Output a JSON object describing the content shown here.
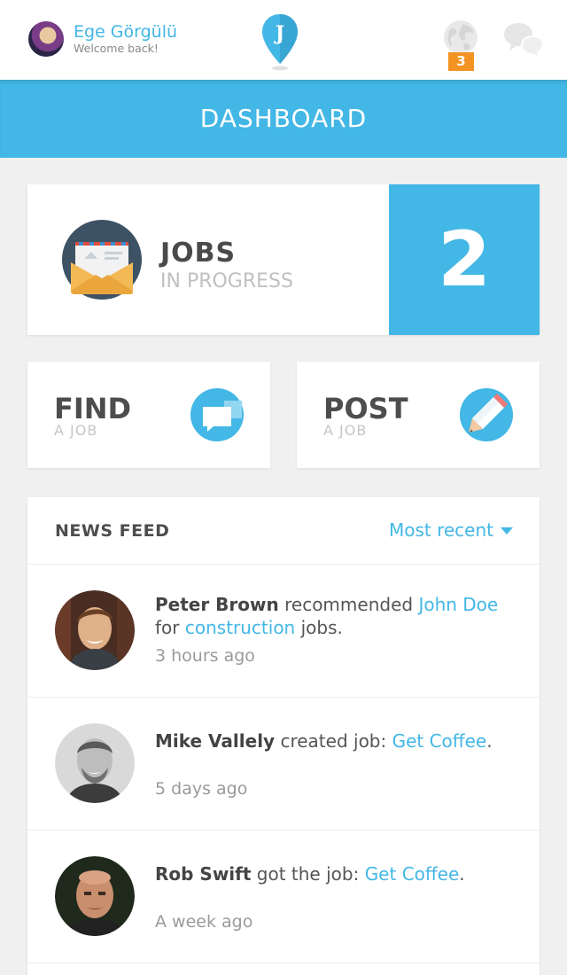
{
  "user": {
    "name": "Ege Görgülü",
    "subtitle": "Welcome back!"
  },
  "logo": {
    "letter": "J"
  },
  "notifications": {
    "count": "3"
  },
  "header": {
    "title": "DASHBOARD"
  },
  "jobs": {
    "title": "JOBS",
    "subtitle": "IN PROGRESS",
    "count": "2"
  },
  "find": {
    "title": "FIND",
    "subtitle": "A JOB"
  },
  "post": {
    "title": "POST",
    "subtitle": "A JOB"
  },
  "feed": {
    "title": "NEWS FEED",
    "sort_label": "Most recent",
    "items": [
      {
        "actor": "Peter Brown",
        "verb": " recommended ",
        "target": "John Doe",
        "mid": " for ",
        "target2": "construction",
        "tail": " jobs.",
        "time": "3 hours ago"
      },
      {
        "actor": "Mike Vallely",
        "verb": " created job: ",
        "target": "Get Coffee",
        "tail": ".",
        "time": "5 days ago"
      },
      {
        "actor": "Rob Swift",
        "verb": " got the job: ",
        "target": "Get Coffee",
        "tail": ".",
        "time": "A week ago"
      }
    ]
  },
  "colors": {
    "accent": "#43b7e5",
    "badge": "#f29322"
  },
  "icons": {
    "globe": "globe-icon",
    "chat": "chat-bubbles-icon",
    "envelope": "envelope-icon",
    "find": "chat-bubble-icon",
    "post": "pencil-icon",
    "sort": "caret-down-icon"
  }
}
